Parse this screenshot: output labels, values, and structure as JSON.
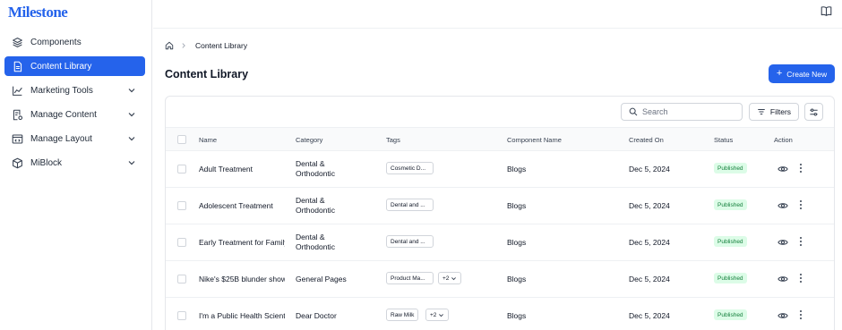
{
  "brand": {
    "logo": "Milestone"
  },
  "sidebar": {
    "items": [
      {
        "label": "Components",
        "icon": "layers-icon"
      },
      {
        "label": "Content Library",
        "icon": "document-icon",
        "active": true
      },
      {
        "label": "Marketing Tools",
        "icon": "chart-line-icon",
        "expandable": true
      },
      {
        "label": "Manage Content",
        "icon": "content-settings-icon",
        "expandable": true
      },
      {
        "label": "Manage Layout",
        "icon": "layout-icon",
        "expandable": true
      },
      {
        "label": "MiBlock",
        "icon": "cube-icon",
        "expandable": true
      }
    ]
  },
  "breadcrumb": {
    "current": "Content Library"
  },
  "page": {
    "title": "Content Library",
    "create_label": "Create New"
  },
  "toolbar": {
    "search_placeholder": "Search",
    "filters_label": "Filters"
  },
  "table": {
    "headers": [
      "Name",
      "Category",
      "Tags",
      "Component Name",
      "Created On",
      "Status",
      "Action"
    ],
    "rows": [
      {
        "name": "Adult Treatment",
        "category": [
          "Dental &",
          "Orthodontic"
        ],
        "tag": "Cosmetic D...",
        "extra": "",
        "component": "Blogs",
        "created": "Dec 5, 2024",
        "status": "Published"
      },
      {
        "name": "Adolescent Treatment",
        "category": [
          "Dental &",
          "Orthodontic"
        ],
        "tag": "Dental and ...",
        "extra": "",
        "component": "Blogs",
        "created": "Dec 5, 2024",
        "status": "Published"
      },
      {
        "name": "Early Treatment for Family",
        "category": [
          "Dental &",
          "Orthodontic"
        ],
        "tag": "Dental and ...",
        "extra": "",
        "component": "Blogs",
        "created": "Dec 5, 2024",
        "status": "Published"
      },
      {
        "name": "Nike's $25B blunder show",
        "category": [
          "General Pages"
        ],
        "tag": "Product Ma...",
        "extra": "+2",
        "component": "Blogs",
        "created": "Dec 5, 2024",
        "status": "Published"
      },
      {
        "name": "I'm a Public Health Scienti",
        "category": [
          "Dear Doctor"
        ],
        "tag": "Raw Milk",
        "extra": "+2",
        "component": "Blogs",
        "created": "Dec 5, 2024",
        "status": "Published"
      }
    ]
  },
  "colors": {
    "accent": "#2563eb",
    "published_bg": "#dcfce7",
    "published_text": "#15803d"
  }
}
